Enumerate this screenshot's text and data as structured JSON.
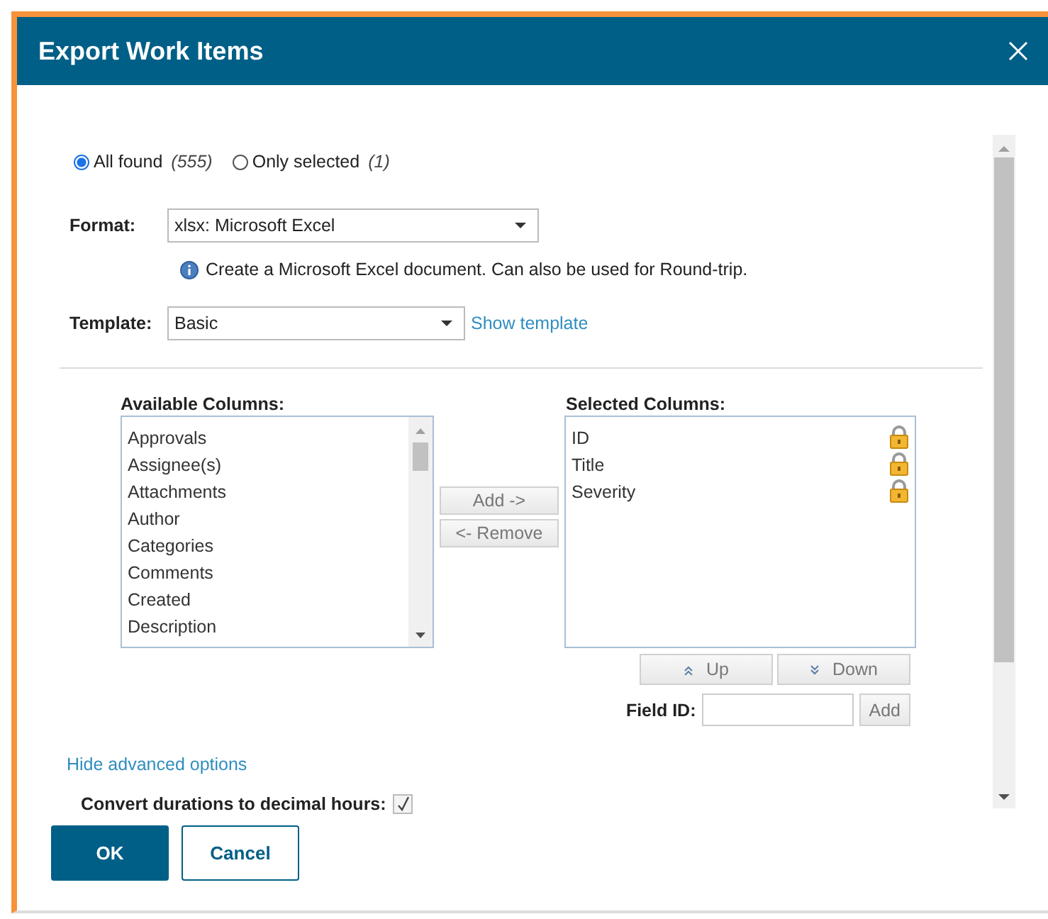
{
  "dialog": {
    "title": "Export Work Items"
  },
  "scope": [
    {
      "label": "All found",
      "count": "(555)",
      "selected": true
    },
    {
      "label": "Only selected",
      "count": "(1)",
      "selected": false
    }
  ],
  "format": {
    "label": "Format:",
    "value": "xlsx: Microsoft Excel",
    "hint": "Create a Microsoft Excel document. Can also be used for Round-trip."
  },
  "template": {
    "label": "Template:",
    "value": "Basic",
    "link": "Show template"
  },
  "available_columns": {
    "label": "Available Columns:",
    "items": [
      "Approvals",
      "Assignee(s)",
      "Attachments",
      "Author",
      "Categories",
      "Comments",
      "Created",
      "Description"
    ]
  },
  "move_buttons": [
    "Add ->",
    "<- Remove"
  ],
  "selected_columns": {
    "label": "Selected Columns:",
    "items": [
      {
        "name": "ID",
        "locked": true
      },
      {
        "name": "Title",
        "locked": true
      },
      {
        "name": "Severity",
        "locked": true
      }
    ]
  },
  "order_buttons": [
    {
      "label": "Up",
      "kind": "up"
    },
    {
      "label": "Down",
      "kind": "down"
    }
  ],
  "field_id": {
    "label": "Field ID:",
    "button": "Add"
  },
  "advanced_link": "Hide advanced options",
  "options": [
    {
      "label": "Convert durations to decimal hours:",
      "checked": true
    }
  ],
  "buttons": [
    {
      "label": "OK",
      "kind": "primary"
    },
    {
      "label": "Cancel",
      "kind": "secondary"
    }
  ]
}
